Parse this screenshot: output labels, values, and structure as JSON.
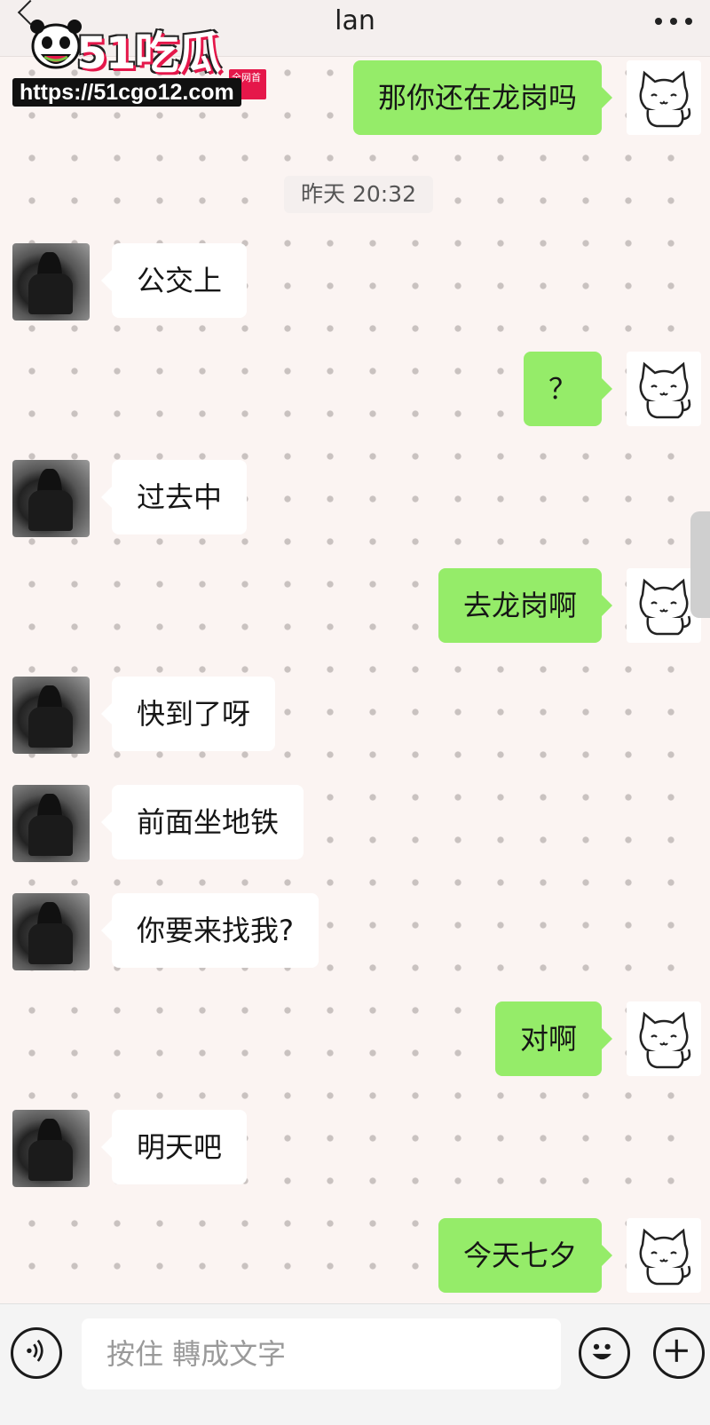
{
  "header": {
    "title": "lan",
    "more_icon": "more-dots-icon",
    "back_icon": "back-arrow-icon"
  },
  "watermark": {
    "logo": "51吃瓜",
    "tag": "全网首发",
    "url": "https://51cgo12.com",
    "mascot_icon": "panda-mascot-icon"
  },
  "timestamp": "昨天 20:32",
  "messages": [
    {
      "side": "right",
      "text": "那你还在龙岗吗"
    },
    {
      "side": "left",
      "text": "公交上"
    },
    {
      "side": "right",
      "text": "？"
    },
    {
      "side": "left",
      "text": "过去中"
    },
    {
      "side": "right",
      "text": "去龙岗啊"
    },
    {
      "side": "left",
      "text": "快到了呀"
    },
    {
      "side": "left",
      "text": "前面坐地铁"
    },
    {
      "side": "left",
      "text": "你要来找我?"
    },
    {
      "side": "right",
      "text": "对啊"
    },
    {
      "side": "left",
      "text": "明天吧"
    },
    {
      "side": "right",
      "text": "今天七夕"
    }
  ],
  "input_bar": {
    "voice_icon": "voice-icon",
    "placeholder": "按住 轉成文字",
    "emoji_icon": "emoji-icon",
    "plus_icon": "plus-icon"
  },
  "colors": {
    "self_bubble": "#95ec69",
    "other_bubble": "#ffffff",
    "background": "#fbf4f2"
  }
}
